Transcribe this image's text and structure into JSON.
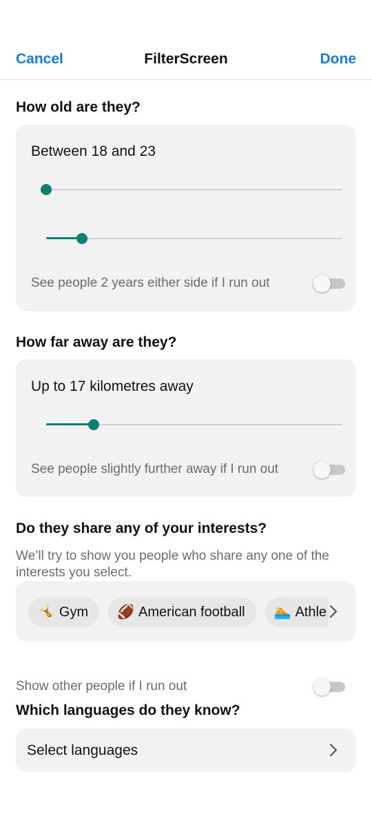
{
  "header": {
    "cancel_label": "Cancel",
    "title": "FilterScreen",
    "done_label": "Done"
  },
  "age": {
    "section_title": "How old are they?",
    "range_text": "Between 18 and 23",
    "toggle_label": "See people 2 years either side if I run out",
    "toggle_on": false,
    "slider_min_level": 0.0,
    "slider_max_level": 0.12
  },
  "distance": {
    "section_title": "How far away are they?",
    "value_text": "Up to 17 kilometres away",
    "toggle_label": "See people slightly further away if I run out",
    "toggle_on": false,
    "slider_level": 0.16
  },
  "interests": {
    "section_title": "Do they share any of your interests?",
    "description": "We’ll try to show you people who share any one of the interests you select.",
    "chips": [
      {
        "icon": "gym-icon",
        "emoji": "🤸",
        "label": "Gym"
      },
      {
        "icon": "american-football-icon",
        "emoji": "🏈",
        "label": "American football"
      },
      {
        "icon": "athletics-icon",
        "emoji": "🏊",
        "label": "Athle"
      }
    ],
    "outside_toggle_label": "Show other people if I run out",
    "outside_toggle_on": false
  },
  "languages": {
    "section_title": "Which languages do they know?",
    "select_label": "Select languages"
  },
  "colors": {
    "accent": "#1a7ad6",
    "slider": "#0f7f72",
    "card_bg": "#f2f2f2"
  }
}
